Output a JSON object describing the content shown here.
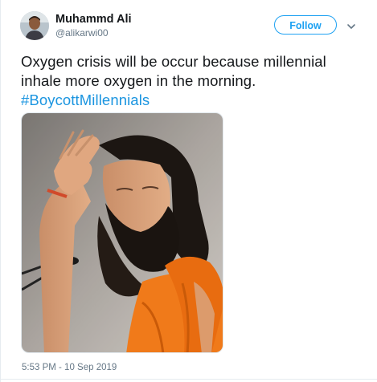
{
  "author": {
    "name": "Muhammd Ali",
    "handle": "@alikarwi00"
  },
  "follow_label": "Follow",
  "tweet": {
    "line1": "Oxygen crisis will be occur because millennial",
    "line2": "inhale more oxygen in the morning.",
    "hashtag": "#BoycottMillennials"
  },
  "timestamp": "5:53 PM - 10 Sep 2019",
  "colors": {
    "accent": "#1da1f2",
    "link": "#1b95e0",
    "muted": "#657786",
    "robe": "#f07a1a"
  },
  "icons": {
    "menu": "chevron-down-icon"
  }
}
